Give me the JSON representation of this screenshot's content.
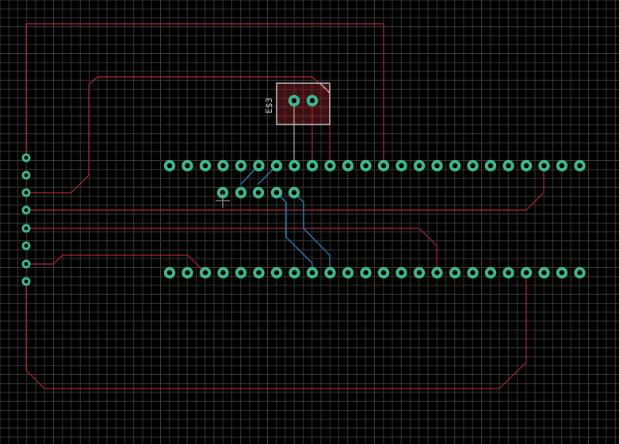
{
  "canvas": {
    "background": "#000000",
    "grid_color": "#3a3a3a"
  },
  "colors": {
    "top_trace": "#b3262f",
    "bottom_trace": "#2f8fd0",
    "silk_wire": "#c8c8a0",
    "pad_ring": "#3fb98f",
    "pad_hole": "#000000",
    "silk_outline": "#c8c8c8",
    "cursor": "#9a9a9a"
  },
  "component": {
    "ref_label": "E$3"
  },
  "icons": {
    "cursor": "crosshair-icon"
  }
}
